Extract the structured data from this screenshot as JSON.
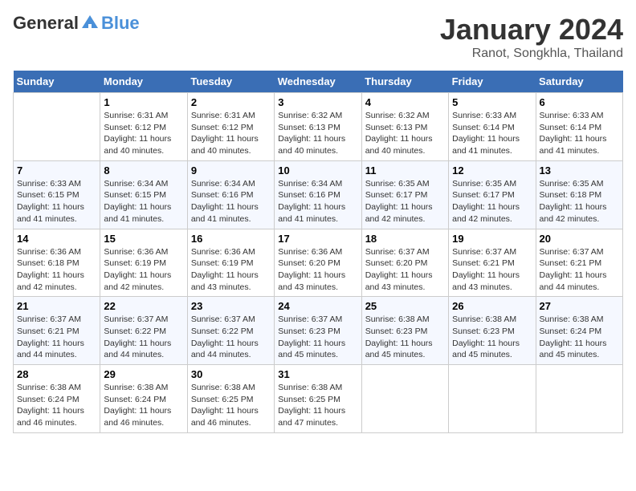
{
  "logo": {
    "general": "General",
    "blue": "Blue"
  },
  "title": "January 2024",
  "subtitle": "Ranot, Songkhla, Thailand",
  "header_days": [
    "Sunday",
    "Monday",
    "Tuesday",
    "Wednesday",
    "Thursday",
    "Friday",
    "Saturday"
  ],
  "weeks": [
    [
      {
        "day": "",
        "info": ""
      },
      {
        "day": "1",
        "info": "Sunrise: 6:31 AM\nSunset: 6:12 PM\nDaylight: 11 hours\nand 40 minutes."
      },
      {
        "day": "2",
        "info": "Sunrise: 6:31 AM\nSunset: 6:12 PM\nDaylight: 11 hours\nand 40 minutes."
      },
      {
        "day": "3",
        "info": "Sunrise: 6:32 AM\nSunset: 6:13 PM\nDaylight: 11 hours\nand 40 minutes."
      },
      {
        "day": "4",
        "info": "Sunrise: 6:32 AM\nSunset: 6:13 PM\nDaylight: 11 hours\nand 40 minutes."
      },
      {
        "day": "5",
        "info": "Sunrise: 6:33 AM\nSunset: 6:14 PM\nDaylight: 11 hours\nand 41 minutes."
      },
      {
        "day": "6",
        "info": "Sunrise: 6:33 AM\nSunset: 6:14 PM\nDaylight: 11 hours\nand 41 minutes."
      }
    ],
    [
      {
        "day": "7",
        "info": "Sunrise: 6:33 AM\nSunset: 6:15 PM\nDaylight: 11 hours\nand 41 minutes."
      },
      {
        "day": "8",
        "info": "Sunrise: 6:34 AM\nSunset: 6:15 PM\nDaylight: 11 hours\nand 41 minutes."
      },
      {
        "day": "9",
        "info": "Sunrise: 6:34 AM\nSunset: 6:16 PM\nDaylight: 11 hours\nand 41 minutes."
      },
      {
        "day": "10",
        "info": "Sunrise: 6:34 AM\nSunset: 6:16 PM\nDaylight: 11 hours\nand 41 minutes."
      },
      {
        "day": "11",
        "info": "Sunrise: 6:35 AM\nSunset: 6:17 PM\nDaylight: 11 hours\nand 42 minutes."
      },
      {
        "day": "12",
        "info": "Sunrise: 6:35 AM\nSunset: 6:17 PM\nDaylight: 11 hours\nand 42 minutes."
      },
      {
        "day": "13",
        "info": "Sunrise: 6:35 AM\nSunset: 6:18 PM\nDaylight: 11 hours\nand 42 minutes."
      }
    ],
    [
      {
        "day": "14",
        "info": "Sunrise: 6:36 AM\nSunset: 6:18 PM\nDaylight: 11 hours\nand 42 minutes."
      },
      {
        "day": "15",
        "info": "Sunrise: 6:36 AM\nSunset: 6:19 PM\nDaylight: 11 hours\nand 42 minutes."
      },
      {
        "day": "16",
        "info": "Sunrise: 6:36 AM\nSunset: 6:19 PM\nDaylight: 11 hours\nand 43 minutes."
      },
      {
        "day": "17",
        "info": "Sunrise: 6:36 AM\nSunset: 6:20 PM\nDaylight: 11 hours\nand 43 minutes."
      },
      {
        "day": "18",
        "info": "Sunrise: 6:37 AM\nSunset: 6:20 PM\nDaylight: 11 hours\nand 43 minutes."
      },
      {
        "day": "19",
        "info": "Sunrise: 6:37 AM\nSunset: 6:21 PM\nDaylight: 11 hours\nand 43 minutes."
      },
      {
        "day": "20",
        "info": "Sunrise: 6:37 AM\nSunset: 6:21 PM\nDaylight: 11 hours\nand 44 minutes."
      }
    ],
    [
      {
        "day": "21",
        "info": "Sunrise: 6:37 AM\nSunset: 6:21 PM\nDaylight: 11 hours\nand 44 minutes."
      },
      {
        "day": "22",
        "info": "Sunrise: 6:37 AM\nSunset: 6:22 PM\nDaylight: 11 hours\nand 44 minutes."
      },
      {
        "day": "23",
        "info": "Sunrise: 6:37 AM\nSunset: 6:22 PM\nDaylight: 11 hours\nand 44 minutes."
      },
      {
        "day": "24",
        "info": "Sunrise: 6:37 AM\nSunset: 6:23 PM\nDaylight: 11 hours\nand 45 minutes."
      },
      {
        "day": "25",
        "info": "Sunrise: 6:38 AM\nSunset: 6:23 PM\nDaylight: 11 hours\nand 45 minutes."
      },
      {
        "day": "26",
        "info": "Sunrise: 6:38 AM\nSunset: 6:23 PM\nDaylight: 11 hours\nand 45 minutes."
      },
      {
        "day": "27",
        "info": "Sunrise: 6:38 AM\nSunset: 6:24 PM\nDaylight: 11 hours\nand 45 minutes."
      }
    ],
    [
      {
        "day": "28",
        "info": "Sunrise: 6:38 AM\nSunset: 6:24 PM\nDaylight: 11 hours\nand 46 minutes."
      },
      {
        "day": "29",
        "info": "Sunrise: 6:38 AM\nSunset: 6:24 PM\nDaylight: 11 hours\nand 46 minutes."
      },
      {
        "day": "30",
        "info": "Sunrise: 6:38 AM\nSunset: 6:25 PM\nDaylight: 11 hours\nand 46 minutes."
      },
      {
        "day": "31",
        "info": "Sunrise: 6:38 AM\nSunset: 6:25 PM\nDaylight: 11 hours\nand 47 minutes."
      },
      {
        "day": "",
        "info": ""
      },
      {
        "day": "",
        "info": ""
      },
      {
        "day": "",
        "info": ""
      }
    ]
  ]
}
